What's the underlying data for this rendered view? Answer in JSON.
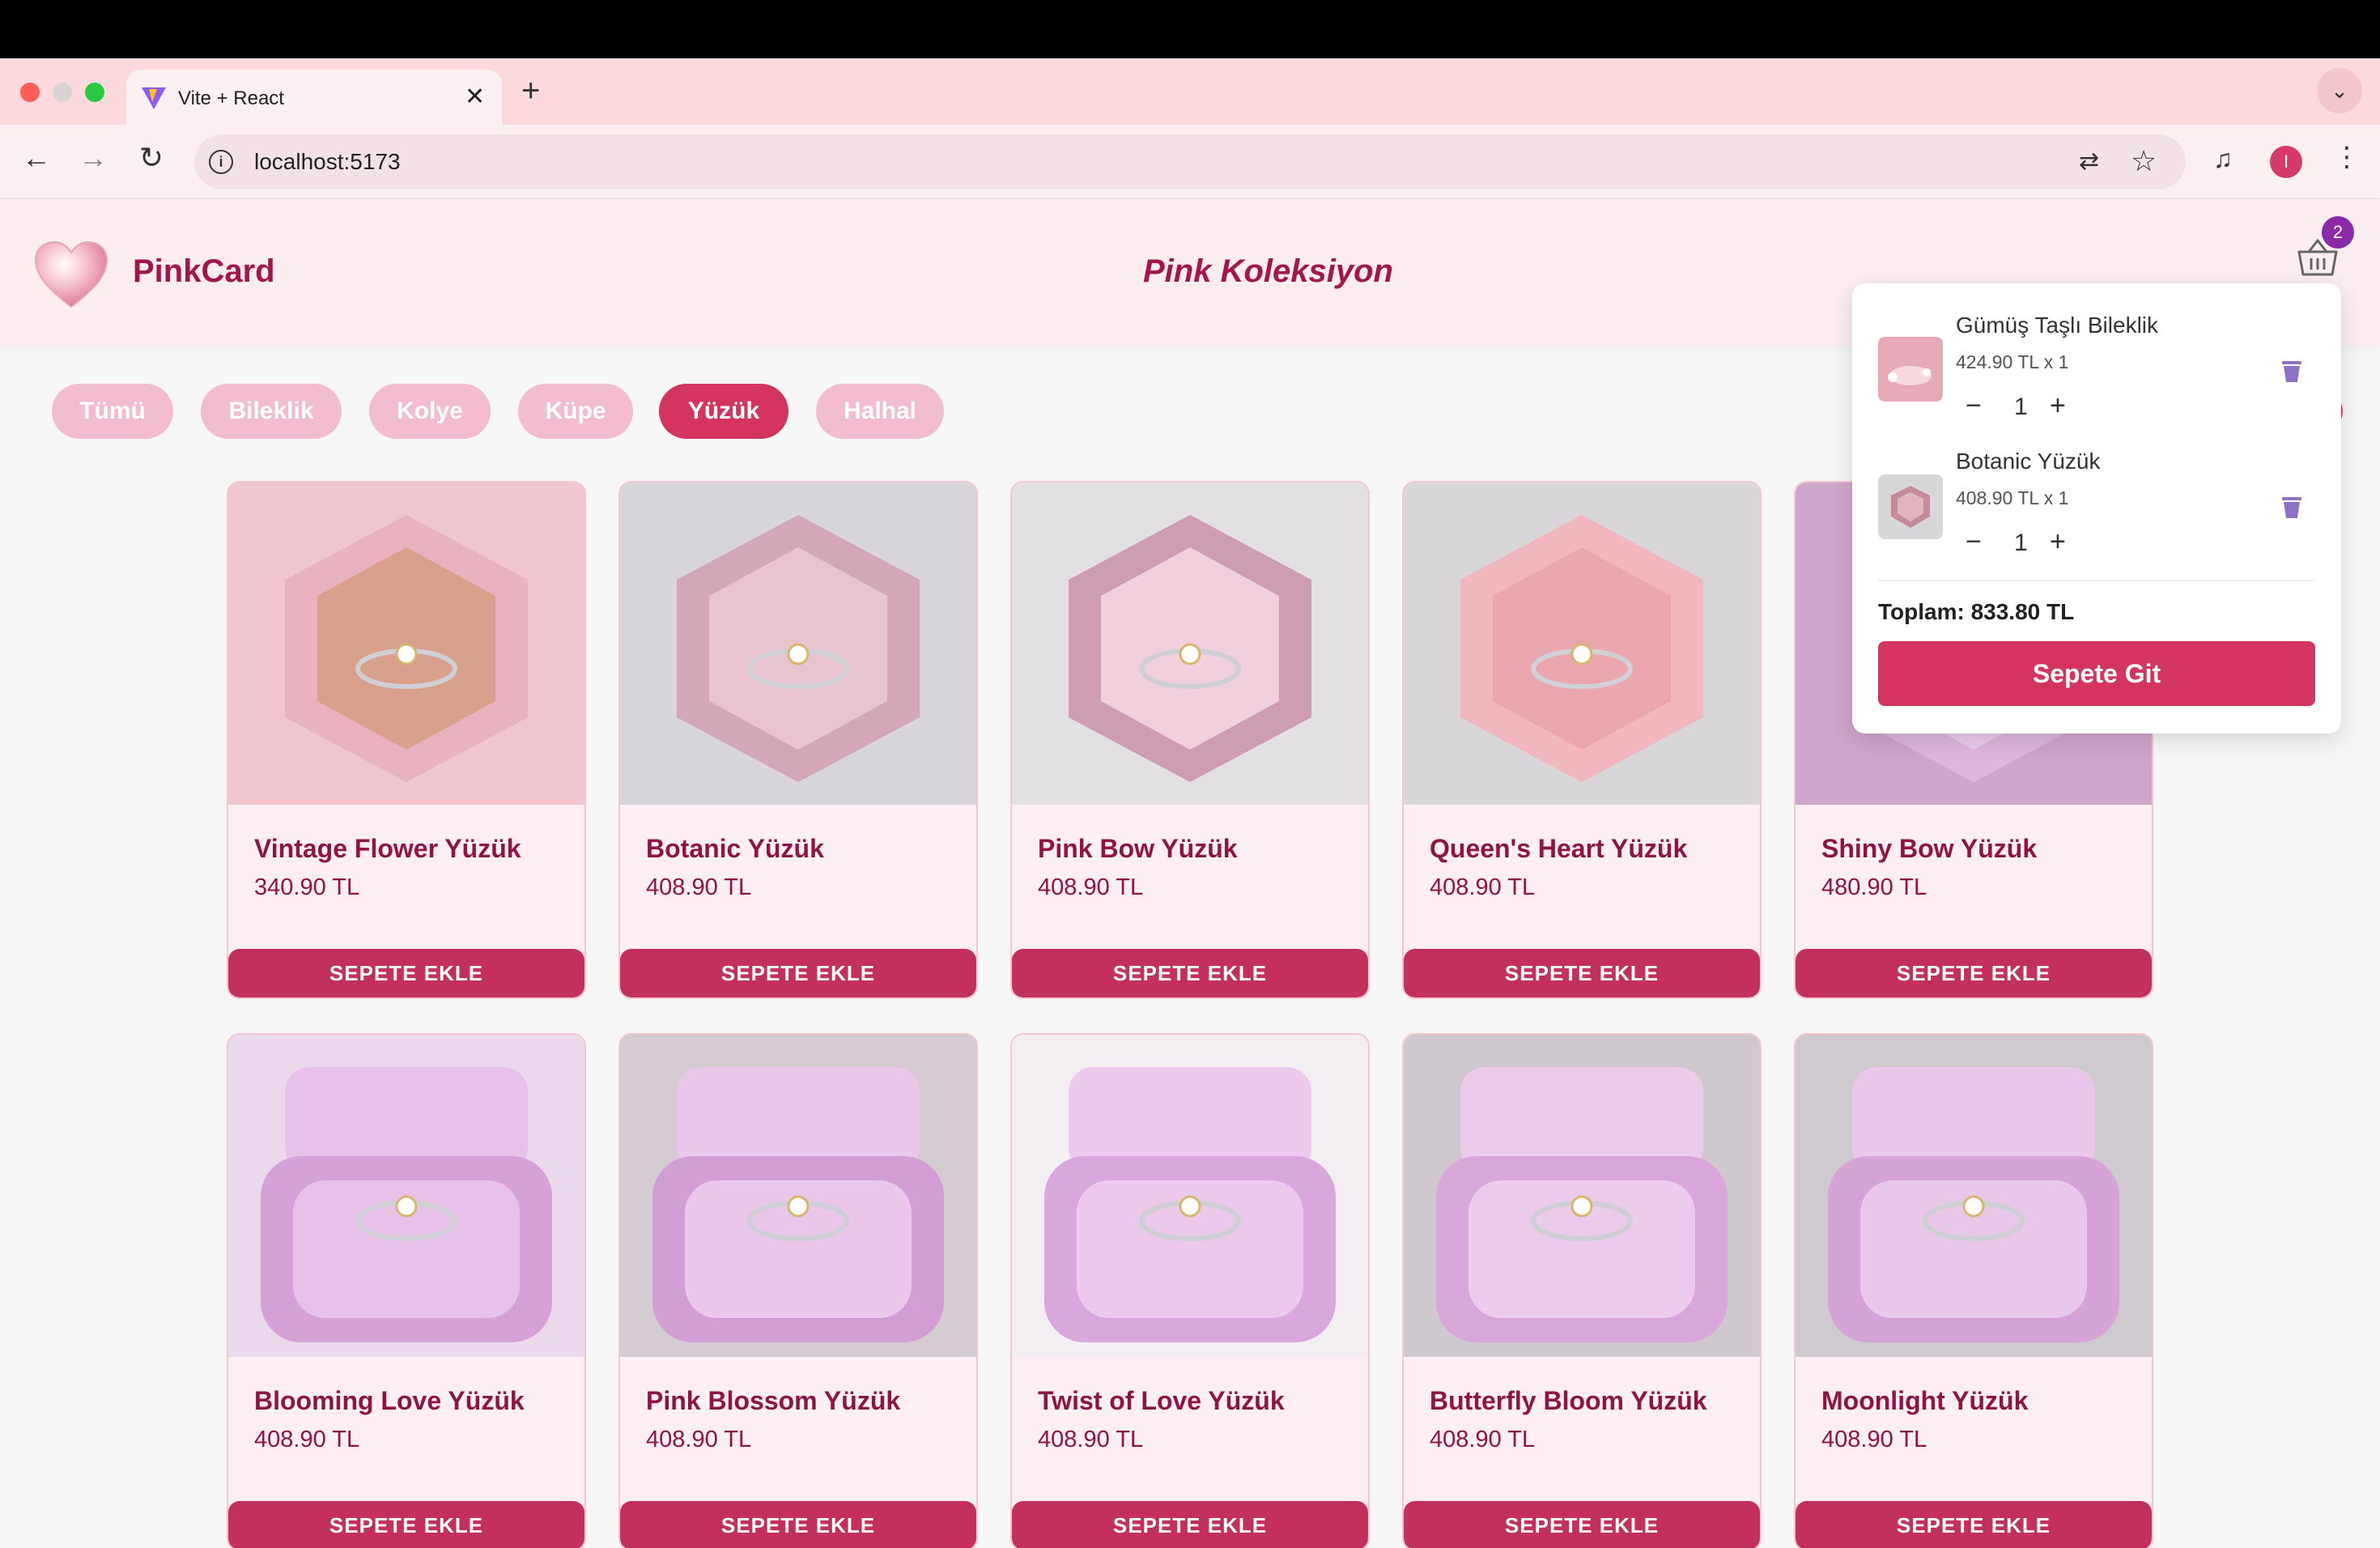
{
  "browser": {
    "tab_title": "Vite + React",
    "tab_close": "✕",
    "new_tab": "+",
    "tab_menu": "⌄",
    "url": "localhost:5173",
    "profile_initial": "I"
  },
  "header": {
    "brand": "PinkCard",
    "collection_title": "Pink Koleksiyon",
    "cart_count": "2"
  },
  "filters": [
    {
      "label": "Tümü"
    },
    {
      "label": "Bileklik"
    },
    {
      "label": "Kolye"
    },
    {
      "label": "Küpe"
    },
    {
      "label": "Yüzük",
      "active": true
    },
    {
      "label": "Halhal"
    }
  ],
  "add_to_cart_label": "SEPETE EKLE",
  "products": [
    {
      "name": "Vintage Flower Yüzük",
      "price": "340.90 TL"
    },
    {
      "name": "Botanic Yüzük",
      "price": "408.90 TL"
    },
    {
      "name": "Pink Bow Yüzük",
      "price": "408.90 TL"
    },
    {
      "name": "Queen's Heart Yüzük",
      "price": "408.90 TL"
    },
    {
      "name": "Shiny Bow Yüzük",
      "price": "480.90 TL"
    },
    {
      "name": "Blooming Love Yüzük",
      "price": "408.90 TL"
    },
    {
      "name": "Pink Blossom Yüzük",
      "price": "408.90 TL"
    },
    {
      "name": "Twist of Love Yüzük",
      "price": "408.90 TL"
    },
    {
      "name": "Butterfly Bloom Yüzük",
      "price": "408.90 TL"
    },
    {
      "name": "Moonlight Yüzük",
      "price": "408.90 TL"
    }
  ],
  "cart": {
    "items": [
      {
        "name": "Gümüş Taşlı Bileklik",
        "price_line": "424.90 TL x 1",
        "qty": "1"
      },
      {
        "name": "Botanic Yüzük",
        "price_line": "408.90 TL x 1",
        "qty": "1"
      }
    ],
    "minus": "−",
    "plus": "+",
    "total": "Toplam: 833.80 TL",
    "checkout_label": "Sepete Git"
  },
  "colors": {
    "accent": "#d33560",
    "brand_text": "#a3164d",
    "chip_inactive": "#f3bcd0",
    "badge": "#8a2aa8"
  }
}
